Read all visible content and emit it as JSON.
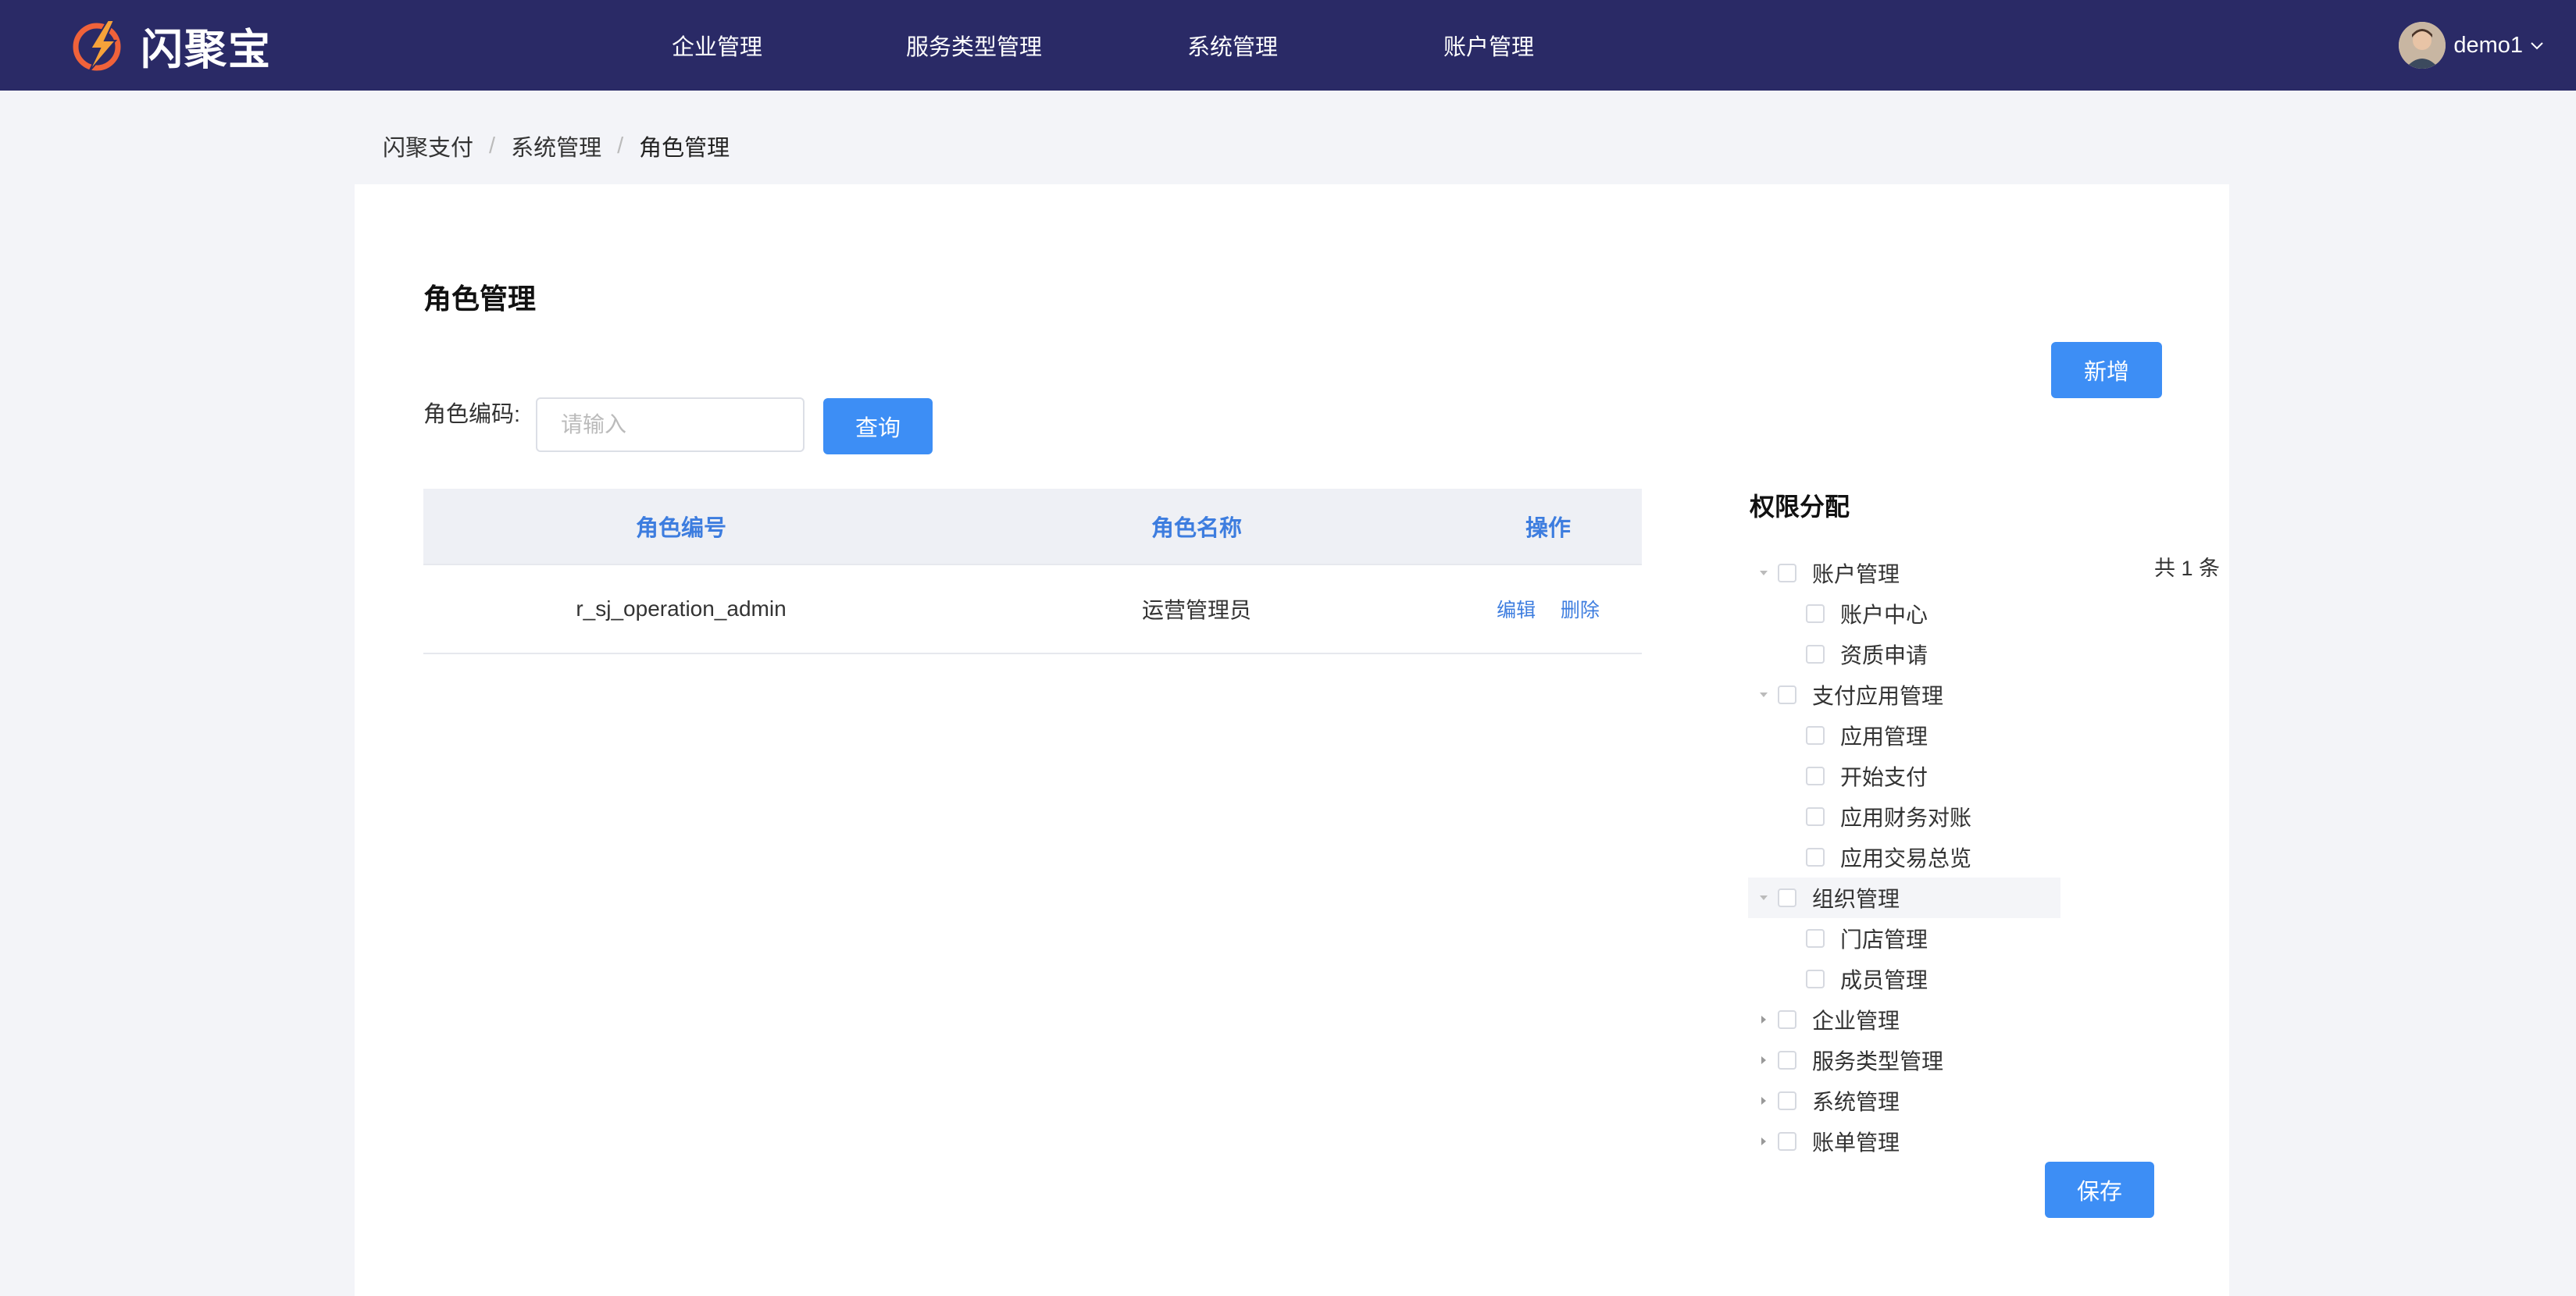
{
  "brand": {
    "name": "闪聚宝",
    "accent": "#3d8ef5",
    "nav_bg": "#2a2a66"
  },
  "nav": {
    "items": [
      "企业管理",
      "服务类型管理",
      "系统管理",
      "账户管理"
    ]
  },
  "user": {
    "name": "demo1"
  },
  "breadcrumb": [
    "闪聚支付",
    "系统管理",
    "角色管理"
  ],
  "page": {
    "title": "角色管理",
    "add_label": "新增",
    "search": {
      "label": "角色编码:",
      "placeholder": "请输入",
      "value": "",
      "query_label": "查询"
    }
  },
  "table": {
    "headers": [
      "角色编号",
      "角色名称",
      "操作"
    ],
    "rows": [
      {
        "code": "r_sj_operation_admin",
        "name": "运营管理员",
        "actions": [
          "编辑",
          "删除"
        ]
      }
    ],
    "total_text": "共 1 条"
  },
  "permissions": {
    "title": "权限分配",
    "tree": [
      {
        "label": "账户管理",
        "expanded": true,
        "children": [
          "账户中心",
          "资质申请"
        ]
      },
      {
        "label": "支付应用管理",
        "expanded": true,
        "children": [
          "应用管理",
          "开始支付",
          "应用财务对账",
          "应用交易总览"
        ]
      },
      {
        "label": "组织管理",
        "expanded": true,
        "highlighted": true,
        "children": [
          "门店管理",
          "成员管理"
        ]
      },
      {
        "label": "企业管理",
        "expanded": false,
        "children": []
      },
      {
        "label": "服务类型管理",
        "expanded": false,
        "children": []
      },
      {
        "label": "系统管理",
        "expanded": false,
        "children": []
      },
      {
        "label": "账单管理",
        "expanded": false,
        "children": []
      }
    ],
    "save_label": "保存"
  }
}
